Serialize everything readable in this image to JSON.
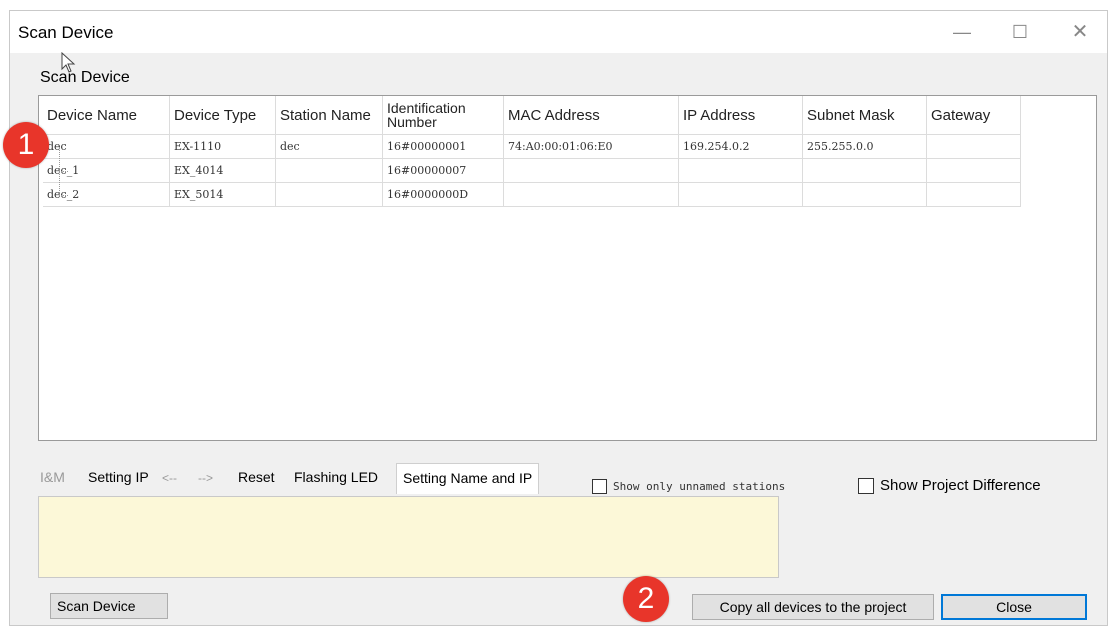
{
  "window": {
    "title": "Scan Device"
  },
  "group": {
    "label": "Scan Device"
  },
  "table": {
    "columns": [
      "Device Name",
      "Device Type",
      "Station Name",
      "Identification Number",
      "MAC Address",
      "IP Address",
      "Subnet Mask",
      "Gateway"
    ],
    "id_header_line1": "Identification",
    "id_header_line2": "Number",
    "rows": [
      {
        "name": "dec",
        "type": "EX-1110",
        "station": "dec",
        "id": "16#00000001",
        "mac": "74:A0:00:01:06:E0",
        "ip": "169.254.0.2",
        "subnet": "255.255.0.0",
        "gateway": ""
      },
      {
        "name": "dec_1",
        "type": "EX_4014",
        "station": "",
        "id": "16#00000007",
        "mac": "",
        "ip": "",
        "subnet": "",
        "gateway": ""
      },
      {
        "name": "dec_2",
        "type": "EX_5014",
        "station": "",
        "id": "16#0000000D",
        "mac": "",
        "ip": "",
        "subnet": "",
        "gateway": ""
      }
    ]
  },
  "badges": {
    "one": "1",
    "two": "2"
  },
  "tabs": {
    "im": "I&M",
    "setting_ip": "Setting IP",
    "arrow_left": "<--",
    "arrow_right": "-->",
    "reset": "Reset",
    "flashing_led": "Flashing LED",
    "setting_name_ip": "Setting Name and IP"
  },
  "options": {
    "unnamed": "Show only unnamed stations",
    "project_diff": "Show Project Difference"
  },
  "buttons": {
    "scan": "Scan Device",
    "copy": "Copy all devices to the project",
    "close": "Close"
  }
}
